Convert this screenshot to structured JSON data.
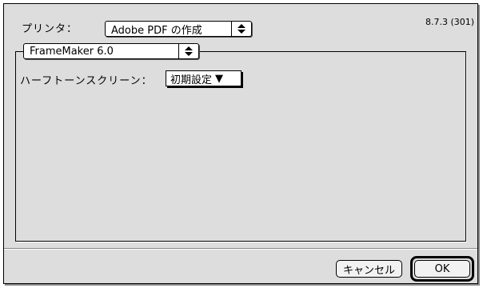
{
  "printer": {
    "label": "プリンタ：",
    "selected": "Adobe PDF の作成",
    "version": "8.7.3 (301)"
  },
  "panel": {
    "selected": "FrameMaker 6.0",
    "halftone_label": "ハーフトーンスクリーン：",
    "halftone_value": "初期設定",
    "halftone_arrow": "▼"
  },
  "buttons": {
    "cancel_label": "キャンセル",
    "ok_label": "OK"
  },
  "icons": {
    "updown": "updown-arrows-icon",
    "dropdown": "triangle-down-icon"
  }
}
